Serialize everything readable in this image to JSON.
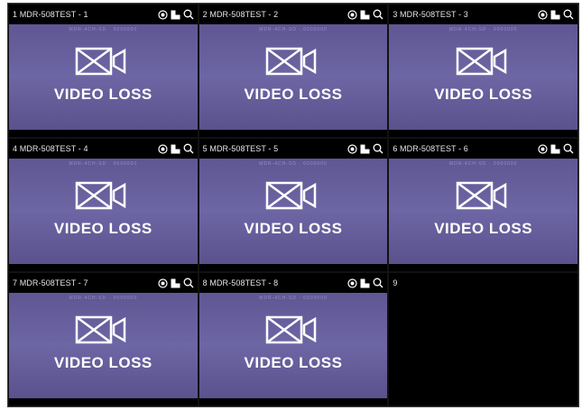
{
  "channels": [
    {
      "title": "1 MDR-508TEST - 1",
      "status": "VIDEO LOSS",
      "watermark": "MDR-4CH-SD · 0000000"
    },
    {
      "title": "2 MDR-508TEST - 2",
      "status": "VIDEO LOSS",
      "watermark": "MDR-4CH-SD · 0000000"
    },
    {
      "title": "3 MDR-508TEST - 3",
      "status": "VIDEO LOSS",
      "watermark": "MDR-4CH-SD · 0000000"
    },
    {
      "title": "4 MDR-508TEST - 4",
      "status": "VIDEO LOSS",
      "watermark": "MDR-4CH-SD · 0000000"
    },
    {
      "title": "5 MDR-508TEST - 5",
      "status": "VIDEO LOSS",
      "watermark": "MDR-4CH-SD · 0000000"
    },
    {
      "title": "6 MDR-508TEST - 6",
      "status": "VIDEO LOSS",
      "watermark": "MDR-4CH-SD · 0000000"
    },
    {
      "title": "7 MDR-508TEST - 7",
      "status": "VIDEO LOSS",
      "watermark": "MDR-4CH-SD · 0000000"
    },
    {
      "title": "8 MDR-508TEST - 8",
      "status": "VIDEO LOSS",
      "watermark": "MDR-4CH-SD · 0000000"
    }
  ],
  "empty_slot": {
    "title": "9"
  },
  "icons": [
    "record-icon",
    "snapshot-icon",
    "zoom-icon",
    "video-loss-camera-icon"
  ],
  "colors": {
    "feed_background": "#6d66a4",
    "header_background": "#000000",
    "text": "#ffffff"
  }
}
